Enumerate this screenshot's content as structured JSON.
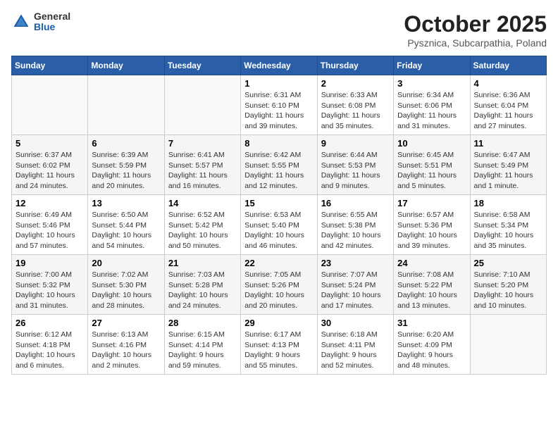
{
  "header": {
    "logo_general": "General",
    "logo_blue": "Blue",
    "month": "October 2025",
    "location": "Pysznica, Subcarpathia, Poland"
  },
  "weekdays": [
    "Sunday",
    "Monday",
    "Tuesday",
    "Wednesday",
    "Thursday",
    "Friday",
    "Saturday"
  ],
  "weeks": [
    [
      {
        "day": "",
        "info": ""
      },
      {
        "day": "",
        "info": ""
      },
      {
        "day": "",
        "info": ""
      },
      {
        "day": "1",
        "info": "Sunrise: 6:31 AM\nSunset: 6:10 PM\nDaylight: 11 hours\nand 39 minutes."
      },
      {
        "day": "2",
        "info": "Sunrise: 6:33 AM\nSunset: 6:08 PM\nDaylight: 11 hours\nand 35 minutes."
      },
      {
        "day": "3",
        "info": "Sunrise: 6:34 AM\nSunset: 6:06 PM\nDaylight: 11 hours\nand 31 minutes."
      },
      {
        "day": "4",
        "info": "Sunrise: 6:36 AM\nSunset: 6:04 PM\nDaylight: 11 hours\nand 27 minutes."
      }
    ],
    [
      {
        "day": "5",
        "info": "Sunrise: 6:37 AM\nSunset: 6:02 PM\nDaylight: 11 hours\nand 24 minutes."
      },
      {
        "day": "6",
        "info": "Sunrise: 6:39 AM\nSunset: 5:59 PM\nDaylight: 11 hours\nand 20 minutes."
      },
      {
        "day": "7",
        "info": "Sunrise: 6:41 AM\nSunset: 5:57 PM\nDaylight: 11 hours\nand 16 minutes."
      },
      {
        "day": "8",
        "info": "Sunrise: 6:42 AM\nSunset: 5:55 PM\nDaylight: 11 hours\nand 12 minutes."
      },
      {
        "day": "9",
        "info": "Sunrise: 6:44 AM\nSunset: 5:53 PM\nDaylight: 11 hours\nand 9 minutes."
      },
      {
        "day": "10",
        "info": "Sunrise: 6:45 AM\nSunset: 5:51 PM\nDaylight: 11 hours\nand 5 minutes."
      },
      {
        "day": "11",
        "info": "Sunrise: 6:47 AM\nSunset: 5:49 PM\nDaylight: 11 hours\nand 1 minute."
      }
    ],
    [
      {
        "day": "12",
        "info": "Sunrise: 6:49 AM\nSunset: 5:46 PM\nDaylight: 10 hours\nand 57 minutes."
      },
      {
        "day": "13",
        "info": "Sunrise: 6:50 AM\nSunset: 5:44 PM\nDaylight: 10 hours\nand 54 minutes."
      },
      {
        "day": "14",
        "info": "Sunrise: 6:52 AM\nSunset: 5:42 PM\nDaylight: 10 hours\nand 50 minutes."
      },
      {
        "day": "15",
        "info": "Sunrise: 6:53 AM\nSunset: 5:40 PM\nDaylight: 10 hours\nand 46 minutes."
      },
      {
        "day": "16",
        "info": "Sunrise: 6:55 AM\nSunset: 5:38 PM\nDaylight: 10 hours\nand 42 minutes."
      },
      {
        "day": "17",
        "info": "Sunrise: 6:57 AM\nSunset: 5:36 PM\nDaylight: 10 hours\nand 39 minutes."
      },
      {
        "day": "18",
        "info": "Sunrise: 6:58 AM\nSunset: 5:34 PM\nDaylight: 10 hours\nand 35 minutes."
      }
    ],
    [
      {
        "day": "19",
        "info": "Sunrise: 7:00 AM\nSunset: 5:32 PM\nDaylight: 10 hours\nand 31 minutes."
      },
      {
        "day": "20",
        "info": "Sunrise: 7:02 AM\nSunset: 5:30 PM\nDaylight: 10 hours\nand 28 minutes."
      },
      {
        "day": "21",
        "info": "Sunrise: 7:03 AM\nSunset: 5:28 PM\nDaylight: 10 hours\nand 24 minutes."
      },
      {
        "day": "22",
        "info": "Sunrise: 7:05 AM\nSunset: 5:26 PM\nDaylight: 10 hours\nand 20 minutes."
      },
      {
        "day": "23",
        "info": "Sunrise: 7:07 AM\nSunset: 5:24 PM\nDaylight: 10 hours\nand 17 minutes."
      },
      {
        "day": "24",
        "info": "Sunrise: 7:08 AM\nSunset: 5:22 PM\nDaylight: 10 hours\nand 13 minutes."
      },
      {
        "day": "25",
        "info": "Sunrise: 7:10 AM\nSunset: 5:20 PM\nDaylight: 10 hours\nand 10 minutes."
      }
    ],
    [
      {
        "day": "26",
        "info": "Sunrise: 6:12 AM\nSunset: 4:18 PM\nDaylight: 10 hours\nand 6 minutes."
      },
      {
        "day": "27",
        "info": "Sunrise: 6:13 AM\nSunset: 4:16 PM\nDaylight: 10 hours\nand 2 minutes."
      },
      {
        "day": "28",
        "info": "Sunrise: 6:15 AM\nSunset: 4:14 PM\nDaylight: 9 hours\nand 59 minutes."
      },
      {
        "day": "29",
        "info": "Sunrise: 6:17 AM\nSunset: 4:13 PM\nDaylight: 9 hours\nand 55 minutes."
      },
      {
        "day": "30",
        "info": "Sunrise: 6:18 AM\nSunset: 4:11 PM\nDaylight: 9 hours\nand 52 minutes."
      },
      {
        "day": "31",
        "info": "Sunrise: 6:20 AM\nSunset: 4:09 PM\nDaylight: 9 hours\nand 48 minutes."
      },
      {
        "day": "",
        "info": ""
      }
    ]
  ]
}
